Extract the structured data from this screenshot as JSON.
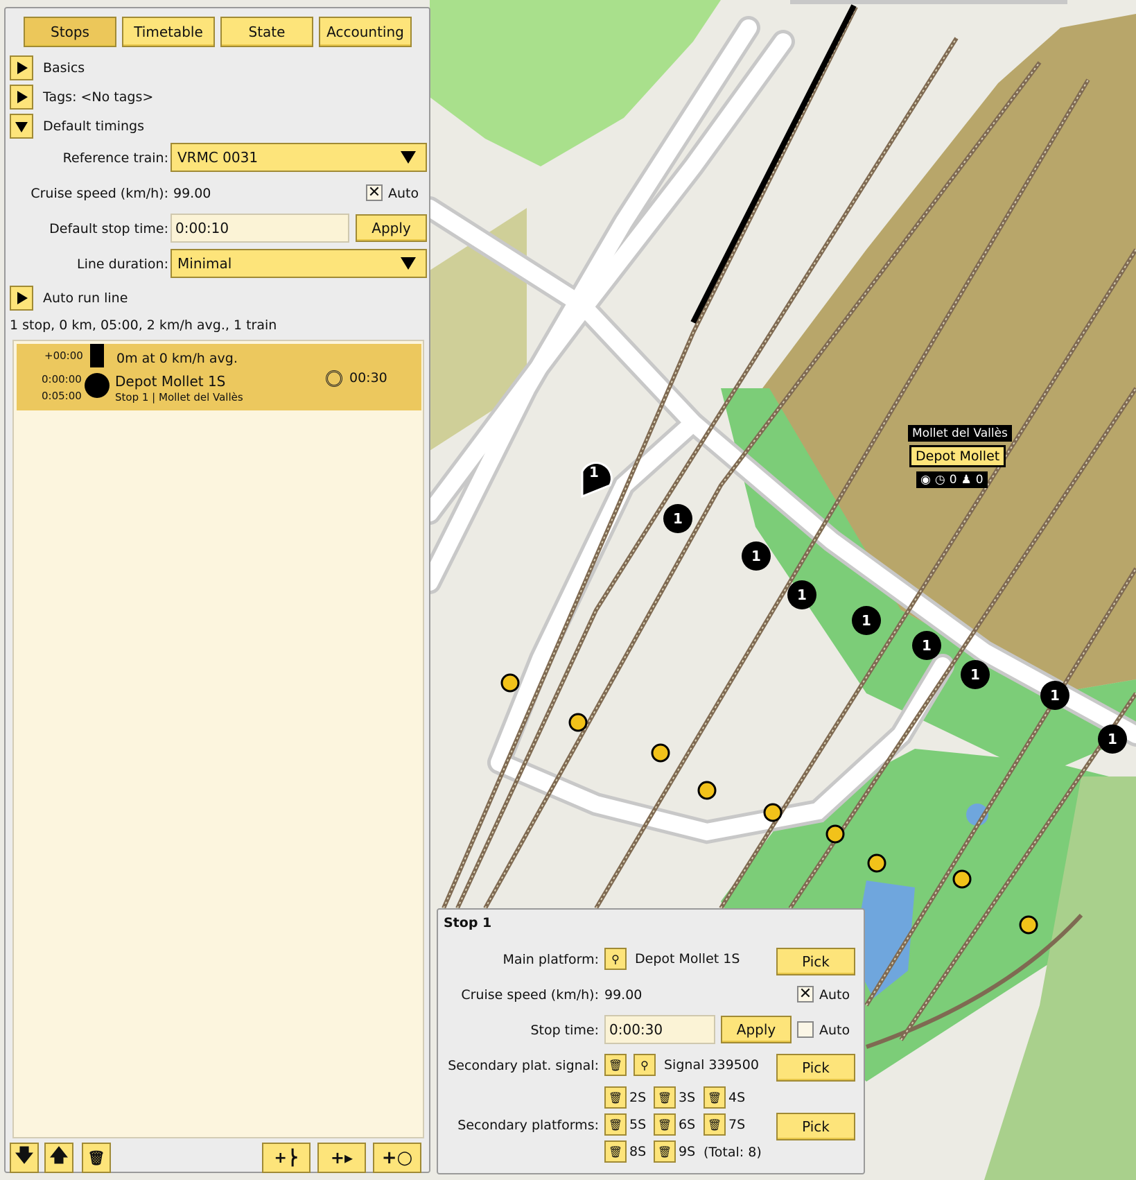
{
  "tabs": [
    "Stops",
    "Timetable",
    "State",
    "Accounting"
  ],
  "sections": {
    "basics": "Basics",
    "tags": "Tags: <No tags>",
    "default_timings": "Default timings",
    "auto_run_line": "Auto run line"
  },
  "timings": {
    "reference_train_label": "Reference train:",
    "reference_train_value": "VRMC 0031",
    "cruise_speed_label": "Cruise speed (km/h):",
    "cruise_speed_value": "99.00",
    "auto_label": "Auto",
    "default_stop_time_label": "Default stop time:",
    "default_stop_time_value": "0:00:10",
    "apply_label": "Apply",
    "line_duration_label": "Line duration:",
    "line_duration_value": "Minimal"
  },
  "summary": "1 stop, 0 km, 05:00, 2 km/h avg., 1 train",
  "stop_list": [
    {
      "offset": "+00:00",
      "segment": "0m at 0 km/h avg.",
      "arrive": "0:00:00",
      "depart": "0:05:00",
      "name": "Depot Mollet 1S",
      "subtitle": "Stop 1 | Mollet del Vallès",
      "dwell": "00:30"
    }
  ],
  "stop_dialog": {
    "title": "Stop 1",
    "main_platform_label": "Main platform:",
    "main_platform_value": "Depot Mollet 1S",
    "pick_label": "Pick",
    "cruise_speed_label": "Cruise speed (km/h):",
    "cruise_speed_value": "99.00",
    "auto_label": "Auto",
    "stop_time_label": "Stop time:",
    "stop_time_value": "0:00:30",
    "apply_label": "Apply",
    "secondary_signal_label": "Secondary plat. signal:",
    "secondary_signal_value": "Signal 339500",
    "secondary_platforms_label": "Secondary platforms:",
    "secondary_platforms": [
      "2S",
      "3S",
      "4S",
      "5S",
      "6S",
      "7S",
      "8S",
      "9S"
    ],
    "total": "(Total: 8)"
  },
  "map": {
    "station_area": "Mollet del Vallès",
    "station_name": "Depot Mollet",
    "stat_a": "0",
    "stat_b": "0",
    "stop_marker": "1"
  },
  "icons": [
    "triangle-right-icon",
    "triangle-down-icon",
    "clock-icon",
    "pin-icon",
    "trash-icon",
    "arrow-down-icon",
    "arrow-up-icon",
    "add-train-icon",
    "add-stop-icon",
    "add-circle-icon"
  ]
}
